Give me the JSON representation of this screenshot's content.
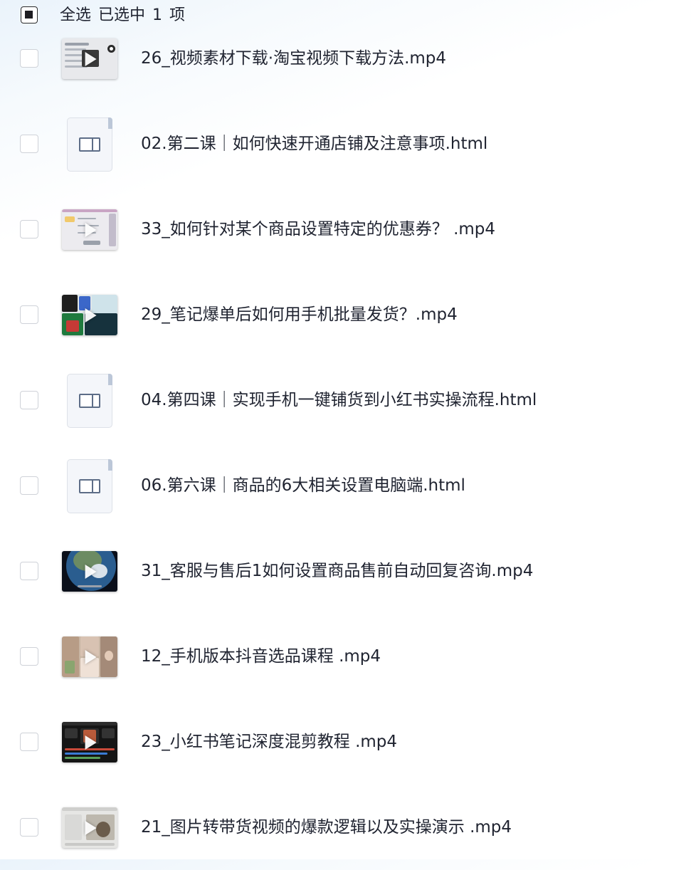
{
  "header": {
    "select_all": "全选",
    "selected_prefix": "已选中",
    "selected_count": "1",
    "selected_suffix": "项"
  },
  "files": [
    {
      "name": "26_视频素材下载·淘宝视频下载方法.mp4",
      "type": "video",
      "thumb": "slides"
    },
    {
      "name": "02.第二课｜如何快速开通店铺及注意事项.html",
      "type": "html"
    },
    {
      "name": "33_如何针对某个商品设置特定的优惠券？ .mp4",
      "type": "video",
      "thumb": "mindmap"
    },
    {
      "name": "29_笔记爆单后如何用手机批量发货？.mp4",
      "type": "video",
      "thumb": "collage"
    },
    {
      "name": "04.第四课｜实现手机一键铺货到小红书实操流程.html",
      "type": "html"
    },
    {
      "name": "06.第六课｜商品的6大相关设置电脑端.html",
      "type": "html"
    },
    {
      "name": "31_客服与售后1如何设置商品售前自动回复咨询.mp4",
      "type": "video",
      "thumb": "earth"
    },
    {
      "name": "12_手机版本抖音选品课程 .mp4",
      "type": "video",
      "thumb": "faces"
    },
    {
      "name": "23_小红书笔记深度混剪教程 .mp4",
      "type": "video",
      "thumb": "editor"
    },
    {
      "name": "21_图片转带货视频的爆款逻辑以及实操演示 .mp4",
      "type": "video",
      "thumb": "desk"
    }
  ],
  "icons": {
    "checkbox": "checkbox-icon",
    "video": "video-thumbnail",
    "html": "html-file-icon",
    "play": "play-icon"
  }
}
